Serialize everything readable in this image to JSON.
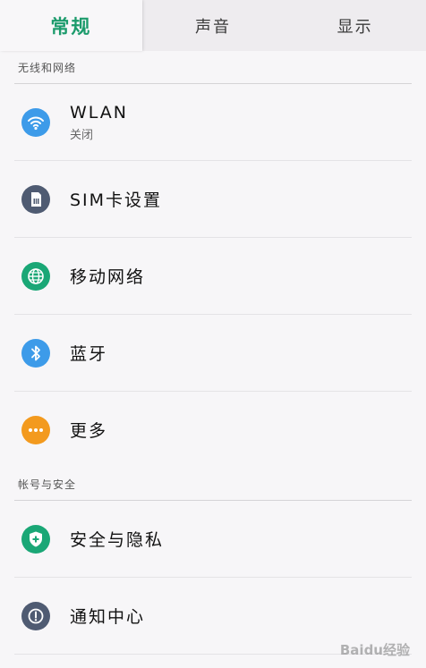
{
  "tabs": [
    {
      "label": "常规",
      "active": true
    },
    {
      "label": "声音",
      "active": false
    },
    {
      "label": "显示",
      "active": false
    }
  ],
  "sections": {
    "network": {
      "title": "无线和网络",
      "items": [
        {
          "label": "WLAN",
          "sublabel": "关闭",
          "icon": "wifi-icon",
          "color": "#3d9be9"
        },
        {
          "label": "SIM卡设置",
          "icon": "sim-card-icon",
          "color": "#4f5b72"
        },
        {
          "label": "移动网络",
          "icon": "globe-icon",
          "color": "#1aa776"
        },
        {
          "label": "蓝牙",
          "icon": "bluetooth-icon",
          "color": "#3d9be9"
        },
        {
          "label": "更多",
          "icon": "more-dots-icon",
          "color": "#f39a1e"
        }
      ]
    },
    "account": {
      "title": "帐号与安全",
      "items": [
        {
          "label": "安全与隐私",
          "icon": "shield-icon",
          "color": "#1aa776"
        },
        {
          "label": "通知中心",
          "icon": "alert-icon",
          "color": "#4f5b72"
        }
      ]
    }
  },
  "watermark": "Baidu经验"
}
